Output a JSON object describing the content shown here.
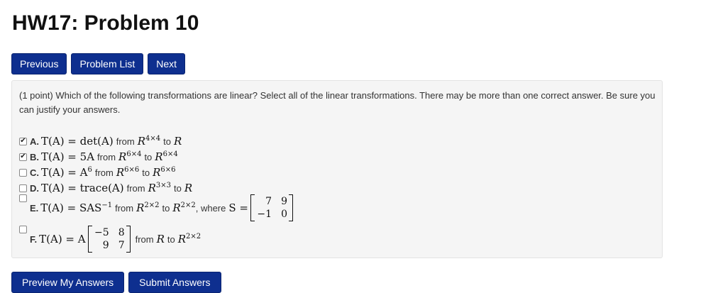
{
  "page": {
    "title": "HW17: Problem 10"
  },
  "nav": {
    "previous": "Previous",
    "problem_list": "Problem List",
    "next": "Next"
  },
  "problem": {
    "points": "(1 point)",
    "prompt": "Which of the following transformations are linear? Select all of the linear transformations. There may be more than one correct answer. Be sure you can justify your answers.",
    "options": [
      {
        "letter": "A.",
        "checked": true,
        "lhs": "T(A) = det(A)",
        "from": "from",
        "domain": "R",
        "domain_sup": "4×4",
        "to": "to",
        "codomain": "R",
        "codomain_sup": ""
      },
      {
        "letter": "B.",
        "checked": true,
        "lhs": "T(A) = 5A",
        "from": "from",
        "domain": "R",
        "domain_sup": "6×4",
        "to": "to",
        "codomain": "R",
        "codomain_sup": "6×4"
      },
      {
        "letter": "C.",
        "checked": false,
        "lhs": "T(A) = A",
        "lhs_sup": "6",
        "from": "from",
        "domain": "R",
        "domain_sup": "6×6",
        "to": "to",
        "codomain": "R",
        "codomain_sup": "6×6"
      },
      {
        "letter": "D.",
        "checked": false,
        "lhs": "T(A) = trace(A)",
        "from": "from",
        "domain": "R",
        "domain_sup": "3×3",
        "to": "to",
        "codomain": "R",
        "codomain_sup": ""
      },
      {
        "letter": "E.",
        "checked": false,
        "lhs": "T(A) = SAS",
        "lhs_sup": "−1",
        "from": "from",
        "domain": "R",
        "domain_sup": "2×2",
        "to": "to",
        "codomain": "R",
        "codomain_sup": "2×2",
        "where": ", where",
        "matrix_name": "S =",
        "matrix": [
          "7",
          "9",
          "−1",
          "0"
        ]
      },
      {
        "letter": "F.",
        "checked": false,
        "lhs": "T(A) = A",
        "matrix": [
          "−5",
          "8",
          "9",
          "7"
        ],
        "from": "from",
        "domain": "R",
        "to": "to",
        "codomain": "R",
        "codomain_sup": "2×2"
      }
    ]
  },
  "actions": {
    "preview": "Preview My Answers",
    "submit": "Submit Answers"
  },
  "colors": {
    "button": "#0e2f8f",
    "panel": "#f5f5f5"
  }
}
